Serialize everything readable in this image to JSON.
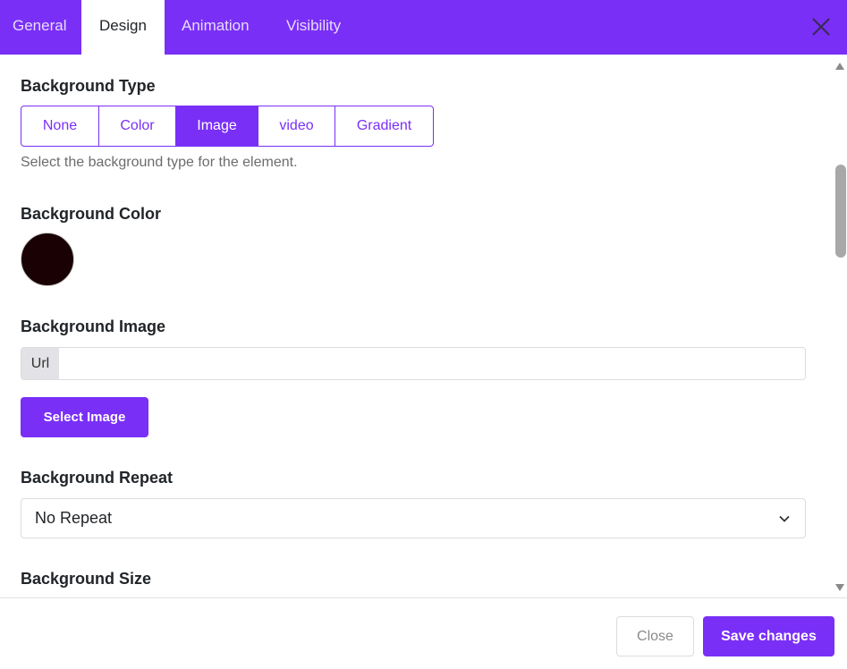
{
  "tabs": [
    {
      "label": "General",
      "active": false
    },
    {
      "label": "Design",
      "active": true
    },
    {
      "label": "Animation",
      "active": false
    },
    {
      "label": "Visibility",
      "active": false
    }
  ],
  "close_icon": "close-icon",
  "sections": {
    "background_type": {
      "title": "Background Type",
      "options": [
        {
          "label": "None",
          "active": false
        },
        {
          "label": "Color",
          "active": false
        },
        {
          "label": "Image",
          "active": true
        },
        {
          "label": "video",
          "active": false
        },
        {
          "label": "Gradient",
          "active": false
        }
      ],
      "help": "Select the background type for the element."
    },
    "background_color": {
      "title": "Background Color",
      "value": "#1a0104"
    },
    "background_image": {
      "title": "Background Image",
      "url_addon": "Url",
      "url_value": "",
      "button_label": "Select Image"
    },
    "background_repeat": {
      "title": "Background Repeat",
      "selected": "No Repeat"
    },
    "background_size": {
      "title": "Background Size"
    }
  },
  "footer": {
    "close_label": "Close",
    "save_label": "Save changes"
  },
  "colors": {
    "accent": "#7a2ff7",
    "swatch": "#1a0104"
  }
}
